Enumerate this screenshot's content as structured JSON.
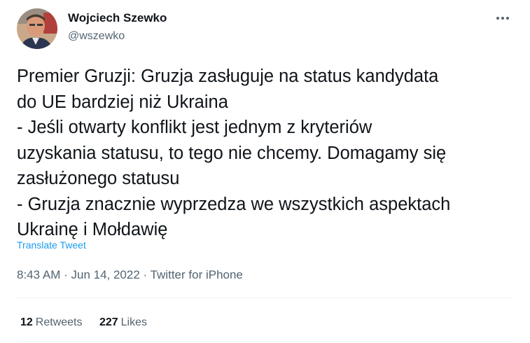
{
  "author": {
    "name": "Wojciech Szewko",
    "handle": "@wszewko"
  },
  "tweet": {
    "lines": [
      "Premier Gruzji: Gruzja zasługuje na status kandydata",
      "do UE bardziej niż Ukraina",
      "- Jeśli otwarty konflikt jest jednym z kryteriów",
      "uzyskania statusu, to tego nie chcemy. Domagamy się",
      "zasłużonego statusu",
      "- Gruzja znacznie wyprzedza we wszystkich aspektach",
      "Ukrainę i Mołdawię"
    ],
    "translate_label": "Translate Tweet"
  },
  "meta": {
    "time": "8:43 AM",
    "separator": " · ",
    "date": "Jun 14, 2022",
    "source": "Twitter for iPhone"
  },
  "stats": {
    "retweets_count": "12",
    "retweets_label": "Retweets",
    "likes_count": "227",
    "likes_label": "Likes"
  },
  "icons": {
    "more": "more-horizontal-icon"
  },
  "colors": {
    "link": "#1d9bf0",
    "secondary_text": "#536471",
    "primary_text": "#0f1419"
  }
}
